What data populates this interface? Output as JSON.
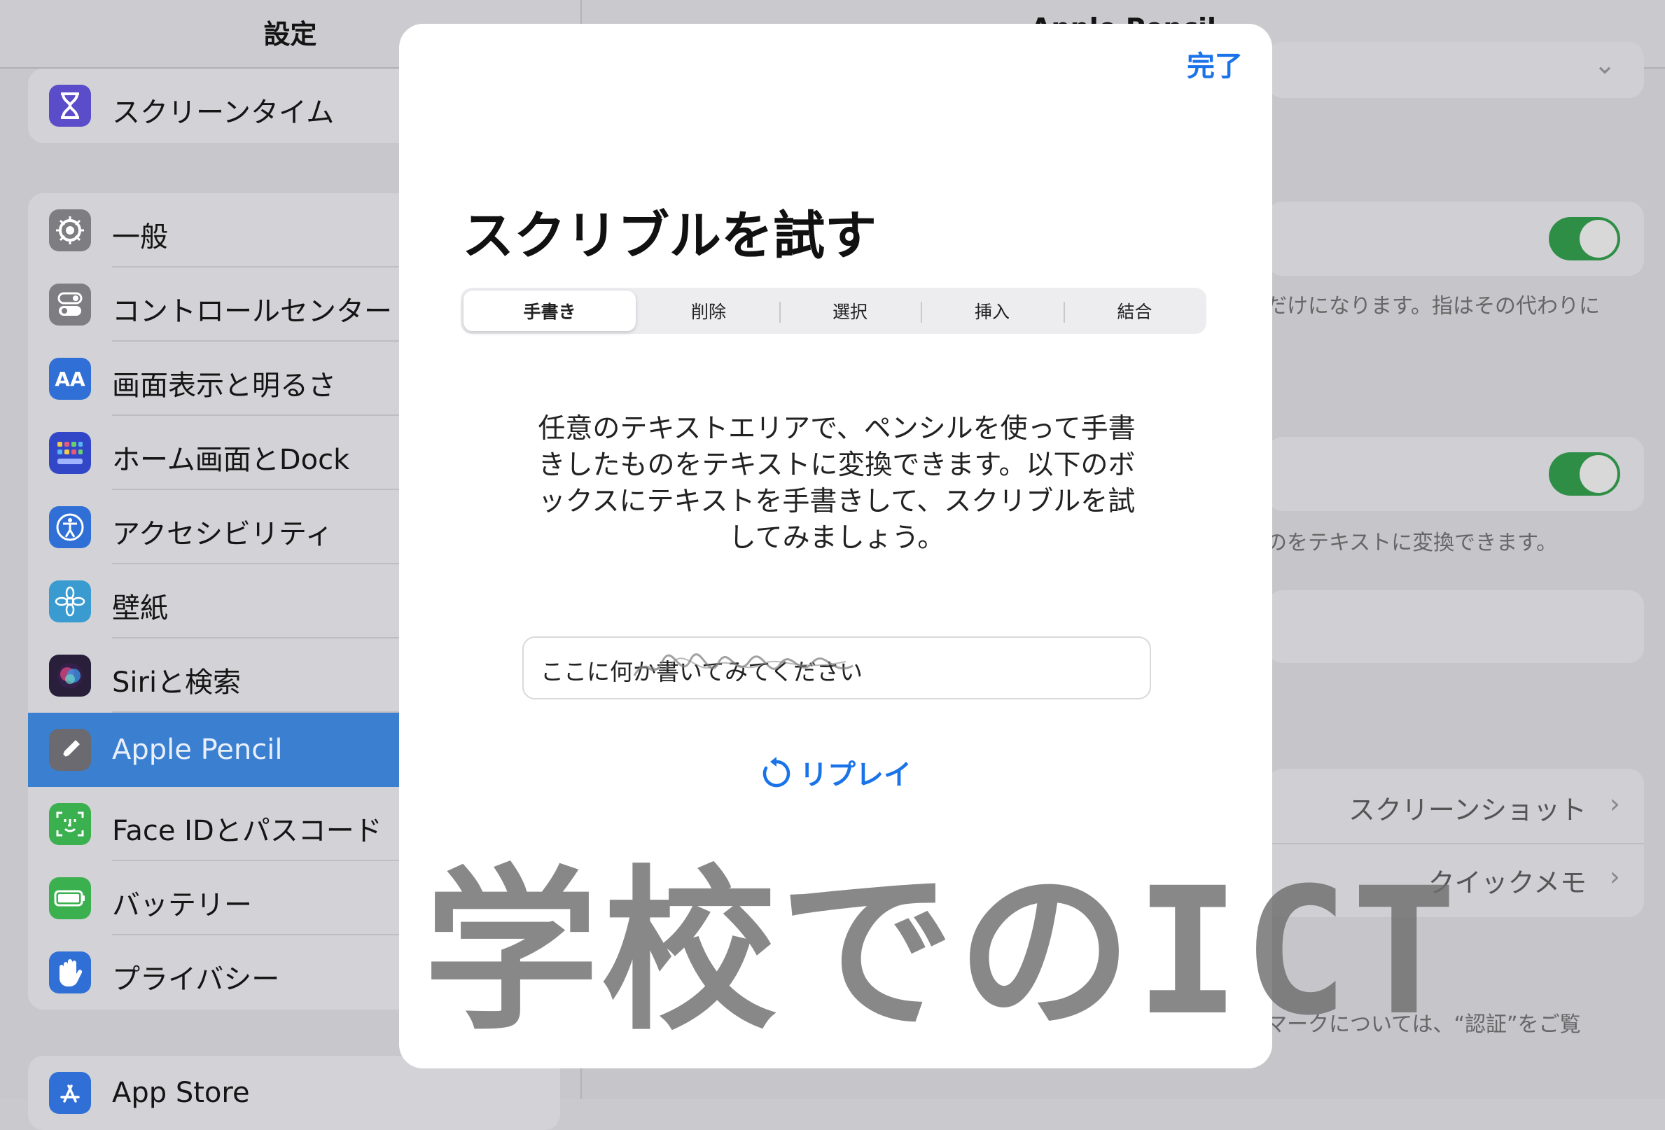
{
  "sidebar": {
    "title": "設定",
    "group1": [
      {
        "label": "スクリーンタイム",
        "icon": "hourglass-icon",
        "color": "#5b4cc9"
      }
    ],
    "group2": [
      {
        "label": "一般",
        "icon": "gear-icon",
        "color": "#7d7d82"
      },
      {
        "label": "コントロールセンター",
        "icon": "toggles-icon",
        "color": "#7d7d82"
      },
      {
        "label": "画面表示と明るさ",
        "icon": "text-size-icon",
        "color": "#2f6fd6"
      },
      {
        "label": "ホーム画面とDock",
        "icon": "home-grid-icon",
        "color": "#3147c8"
      },
      {
        "label": "アクセシビリティ",
        "icon": "accessibility-icon",
        "color": "#2f6fd6"
      },
      {
        "label": "壁紙",
        "icon": "flower-icon",
        "color": "#3a9bd0"
      },
      {
        "label": "Siriと検索",
        "icon": "siri-icon",
        "color": "#3a2c4e"
      },
      {
        "label": "Apple Pencil",
        "icon": "pencil-icon",
        "color": "#7d7d82",
        "selected": true
      },
      {
        "label": "Face IDとパスコード",
        "icon": "face-id-icon",
        "color": "#3bb04f"
      },
      {
        "label": "バッテリー",
        "icon": "battery-icon",
        "color": "#3bb04f"
      },
      {
        "label": "プライバシー",
        "icon": "hand-icon",
        "color": "#2f6fd6"
      }
    ],
    "group3": [
      {
        "label": "App Store",
        "icon": "app-store-icon",
        "color": "#2f6fd6"
      }
    ]
  },
  "detail": {
    "title": "Apple Pencil",
    "text1": "だけになります。指はその代わりに",
    "text2": "のをテキストに変換できます。",
    "link1": "スクリーンショット",
    "link2": "クイックメモ",
    "footer": "マークについては、“認証”をご覧"
  },
  "modal": {
    "done": "完了",
    "title": "スクリブルを試す",
    "tabs": [
      "手書き",
      "削除",
      "選択",
      "挿入",
      "結合"
    ],
    "active_tab": "手書き",
    "description": "任意のテキストエリアで、ペンシルを使って手書きしたものをテキストに変換できます。以下のボックスにテキストを手書きして、スクリブルを試してみましょう。",
    "field_text": "ここに何か書いてみてください",
    "replay": "リプレイ"
  },
  "watermark": "学校でのICT",
  "colors": {
    "accent": "#1a73e8",
    "toggle_on": "#2e8e46",
    "selected_row": "#3a7fd0"
  }
}
